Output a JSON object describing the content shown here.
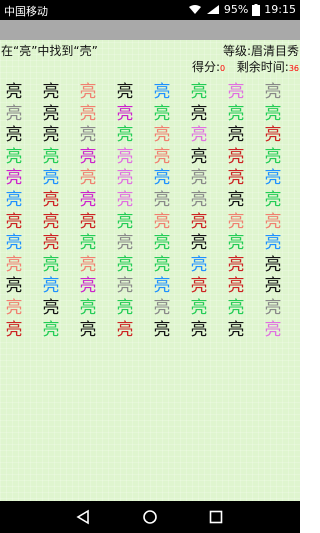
{
  "statusbar": {
    "carrier": "中国移动",
    "network": "4G",
    "battery": "95%",
    "time": "19:15"
  },
  "header": {
    "instruction": "在“亮”中找到“壳”",
    "level_label": "等级:",
    "level_value": "眉清目秀",
    "score_label": "得分:",
    "score_value": "0",
    "timer_label": "剩余时间:",
    "timer_value": "36"
  },
  "grid": {
    "rows": [
      [
        {
          "char": "亮",
          "color": "#111111"
        },
        {
          "char": "亮",
          "color": "#111111"
        },
        {
          "char": "亮",
          "color": "#f08070"
        },
        {
          "char": "亮",
          "color": "#111111"
        },
        {
          "char": "亮",
          "color": "#1e90ff"
        },
        {
          "char": "亮",
          "color": "#22cc55"
        },
        {
          "char": "亮",
          "color": "#e070e0"
        },
        {
          "char": "亮",
          "color": "#888888"
        }
      ],
      [
        {
          "char": "亮",
          "color": "#888888"
        },
        {
          "char": "亮",
          "color": "#111111"
        },
        {
          "char": "亮",
          "color": "#f08070"
        },
        {
          "char": "亮",
          "color": "#cc22cc"
        },
        {
          "char": "亮",
          "color": "#22cc55"
        },
        {
          "char": "亮",
          "color": "#111111"
        },
        {
          "char": "亮",
          "color": "#22cc55"
        },
        {
          "char": "亮",
          "color": "#22cc55"
        }
      ],
      [
        {
          "char": "亮",
          "color": "#111111"
        },
        {
          "char": "亮",
          "color": "#111111"
        },
        {
          "char": "亮",
          "color": "#888888"
        },
        {
          "char": "亮",
          "color": "#22cc55"
        },
        {
          "char": "亮",
          "color": "#f08070"
        },
        {
          "char": "亮",
          "color": "#e070e0"
        },
        {
          "char": "亮",
          "color": "#111111"
        },
        {
          "char": "亮",
          "color": "#cc2222"
        }
      ],
      [
        {
          "char": "亮",
          "color": "#22cc55"
        },
        {
          "char": "亮",
          "color": "#22cc55"
        },
        {
          "char": "亮",
          "color": "#cc22cc"
        },
        {
          "char": "亮",
          "color": "#e070e0"
        },
        {
          "char": "亮",
          "color": "#f08070"
        },
        {
          "char": "亮",
          "color": "#111111"
        },
        {
          "char": "亮",
          "color": "#cc2222"
        },
        {
          "char": "亮",
          "color": "#22cc55"
        }
      ],
      [
        {
          "char": "亮",
          "color": "#cc22cc"
        },
        {
          "char": "亮",
          "color": "#1e90ff"
        },
        {
          "char": "亮",
          "color": "#f08070"
        },
        {
          "char": "亮",
          "color": "#e070e0"
        },
        {
          "char": "亮",
          "color": "#1e90ff"
        },
        {
          "char": "亮",
          "color": "#888888"
        },
        {
          "char": "亮",
          "color": "#cc2222"
        },
        {
          "char": "亮",
          "color": "#1e90ff"
        }
      ],
      [
        {
          "char": "亮",
          "color": "#1e90ff"
        },
        {
          "char": "亮",
          "color": "#cc2222"
        },
        {
          "char": "亮",
          "color": "#cc22cc"
        },
        {
          "char": "亮",
          "color": "#e070e0"
        },
        {
          "char": "亮",
          "color": "#888888"
        },
        {
          "char": "亮",
          "color": "#888888"
        },
        {
          "char": "亮",
          "color": "#111111"
        },
        {
          "char": "亮",
          "color": "#22cc55"
        }
      ],
      [
        {
          "char": "亮",
          "color": "#cc2222"
        },
        {
          "char": "亮",
          "color": "#cc2222"
        },
        {
          "char": "亮",
          "color": "#cc2222"
        },
        {
          "char": "亮",
          "color": "#22cc55"
        },
        {
          "char": "亮",
          "color": "#f08070"
        },
        {
          "char": "亮",
          "color": "#cc2222"
        },
        {
          "char": "亮",
          "color": "#f08070"
        },
        {
          "char": "亮",
          "color": "#f08070"
        }
      ],
      [
        {
          "char": "亮",
          "color": "#1e90ff"
        },
        {
          "char": "亮",
          "color": "#cc2222"
        },
        {
          "char": "亮",
          "color": "#22cc55"
        },
        {
          "char": "亮",
          "color": "#888888"
        },
        {
          "char": "亮",
          "color": "#22cc55"
        },
        {
          "char": "亮",
          "color": "#111111"
        },
        {
          "char": "亮",
          "color": "#22cc55"
        },
        {
          "char": "亮",
          "color": "#1e90ff"
        }
      ],
      [
        {
          "char": "亮",
          "color": "#f08070"
        },
        {
          "char": "亮",
          "color": "#22cc55"
        },
        {
          "char": "亮",
          "color": "#f08070"
        },
        {
          "char": "亮",
          "color": "#22cc55"
        },
        {
          "char": "亮",
          "color": "#22cc55"
        },
        {
          "char": "亮",
          "color": "#1e90ff"
        },
        {
          "char": "亮",
          "color": "#cc2222"
        },
        {
          "char": "亮",
          "color": "#111111"
        }
      ],
      [
        {
          "char": "亮",
          "color": "#111111"
        },
        {
          "char": "亮",
          "color": "#1e90ff"
        },
        {
          "char": "亮",
          "color": "#cc22cc"
        },
        {
          "char": "亮",
          "color": "#888888"
        },
        {
          "char": "亮",
          "color": "#1e90ff"
        },
        {
          "char": "亮",
          "color": "#cc2222"
        },
        {
          "char": "亮",
          "color": "#cc2222"
        },
        {
          "char": "亮",
          "color": "#111111"
        }
      ],
      [
        {
          "char": "亮",
          "color": "#f08070"
        },
        {
          "char": "亮",
          "color": "#111111"
        },
        {
          "char": "亮",
          "color": "#22cc55"
        },
        {
          "char": "亮",
          "color": "#22cc55"
        },
        {
          "char": "亮",
          "color": "#888888"
        },
        {
          "char": "亮",
          "color": "#22cc55"
        },
        {
          "char": "亮",
          "color": "#22cc55"
        },
        {
          "char": "亮",
          "color": "#888888"
        }
      ],
      [
        {
          "char": "亮",
          "color": "#cc2222"
        },
        {
          "char": "亮",
          "color": "#22cc55"
        },
        {
          "char": "亮",
          "color": "#111111"
        },
        {
          "char": "亮",
          "color": "#cc2222"
        },
        {
          "char": "亮",
          "color": "#111111"
        },
        {
          "char": "亮",
          "color": "#111111"
        },
        {
          "char": "亮",
          "color": "#111111"
        },
        {
          "char": "亮",
          "color": "#e070e0"
        }
      ]
    ]
  },
  "navbar": {
    "back_icon": "back-triangle-icon",
    "home_icon": "home-circle-icon",
    "recents_icon": "recents-square-icon"
  }
}
